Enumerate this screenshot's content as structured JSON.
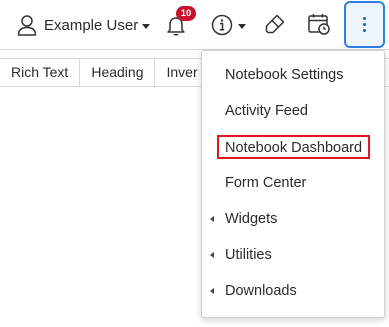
{
  "header": {
    "user_name": "Example User",
    "notification_count": "10"
  },
  "icons": {
    "user": "user-icon",
    "bell": "bell-icon",
    "info": "info-icon",
    "eraser": "eraser-icon",
    "calendar": "calendar-clock-icon",
    "more": "more-vertical-icon"
  },
  "colors": {
    "badge": "#c8102e",
    "accent": "#2f7fe8",
    "highlight": "#e0191e"
  },
  "format_toolbar": {
    "items": [
      "Rich Text",
      "Heading",
      "Inver"
    ]
  },
  "menu": {
    "items": [
      {
        "label": "Notebook Settings",
        "submenu": false
      },
      {
        "label": "Activity Feed",
        "submenu": false
      },
      {
        "label": "Notebook Dashboard",
        "submenu": false,
        "highlighted": true
      },
      {
        "label": "Form Center",
        "submenu": false
      },
      {
        "label": "Widgets",
        "submenu": true
      },
      {
        "label": "Utilities",
        "submenu": true
      },
      {
        "label": "Downloads",
        "submenu": true
      }
    ]
  }
}
